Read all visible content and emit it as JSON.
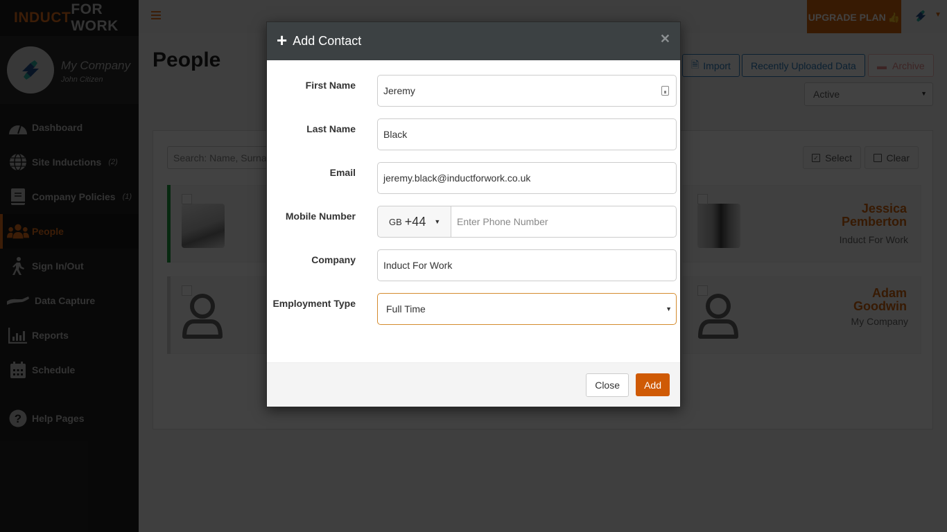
{
  "brand": {
    "part1": "INDUCT",
    "part2": "FOR WORK"
  },
  "profile": {
    "company": "My Company",
    "user": "John Citizen"
  },
  "sidebar": {
    "items": [
      {
        "label": "Dashboard",
        "icon": "dashboard-gauge-icon",
        "count": ""
      },
      {
        "label": "Site Inductions",
        "icon": "globe-icon",
        "count": "(2)"
      },
      {
        "label": "Company Policies",
        "icon": "book-icon",
        "count": "(1)"
      },
      {
        "label": "People",
        "icon": "users-icon",
        "count": "",
        "active": true
      },
      {
        "label": "Sign In/Out",
        "icon": "walking-icon",
        "count": ""
      },
      {
        "label": "Data Capture",
        "icon": "hand-icon",
        "count": ""
      },
      {
        "label": "Reports",
        "icon": "bar-chart-icon",
        "count": ""
      },
      {
        "label": "Schedule",
        "icon": "calendar-icon",
        "count": ""
      },
      {
        "label": "Help Pages",
        "icon": "question-circle-icon",
        "count": ""
      }
    ]
  },
  "topbar": {
    "upgrade_label": "UPGRADE PLAN"
  },
  "main": {
    "title": "People",
    "import_label": "Import",
    "recent_label": "Recently Uploaded Data",
    "archive_label": "Archive",
    "status_value": "Active",
    "search_placeholder": "Search: Name, Surname",
    "select_label": "Select",
    "clear_label": "Clear",
    "people": [
      {
        "first": "Jessica",
        "last": "Pemberton",
        "company": "Induct For Work"
      },
      {
        "first": "Adam",
        "last": "Goodwin",
        "company": "My Company"
      }
    ]
  },
  "modal": {
    "title": "Add Contact",
    "fields": {
      "first_name": {
        "label": "First Name",
        "value": "Jeremy"
      },
      "last_name": {
        "label": "Last Name",
        "value": "Black"
      },
      "email": {
        "label": "Email",
        "value": "jeremy.black@inductforwork.co.uk"
      },
      "mobile": {
        "label": "Mobile Number",
        "country": "GB",
        "dial_code": "+44",
        "placeholder": "Enter Phone Number",
        "value": ""
      },
      "company": {
        "label": "Company",
        "value": "Induct For Work"
      },
      "employment_type": {
        "label": "Employment Type",
        "value": "Full Time"
      }
    },
    "close_label": "Close",
    "add_label": "Add"
  },
  "colors": {
    "accent": "#cf5a05",
    "brand_orange": "#e86f1c",
    "header_dark": "#3c4143",
    "active_green": "#1e9e3e"
  }
}
